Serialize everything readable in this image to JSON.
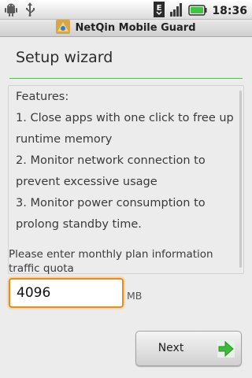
{
  "status_bar": {
    "time": "18:36",
    "icons": [
      "android-debug-icon",
      "usb-icon",
      "edge-network-icon",
      "signal-icon",
      "battery-icon"
    ],
    "network_label": "E"
  },
  "title_bar": {
    "title": "NetQin Mobile Guard",
    "icon": "app-icon"
  },
  "wizard": {
    "heading": "Setup wizard",
    "features_lines": [
      "Features:",
      "1. Close apps with one click to free up",
      "runtime memory",
      "2. Monitor network connection to",
      "prevent excessive usage",
      "3. Monitor power consumption to",
      "prolong standby time."
    ],
    "prompt": "Please enter monthly plan information traffic quota",
    "quota_value": "4096",
    "unit": "MB",
    "next_label": "Next"
  },
  "colors": {
    "accent_divider": "#3bd23b",
    "input_focus": "#f08c15",
    "next_arrow": "#3dbb3d"
  }
}
